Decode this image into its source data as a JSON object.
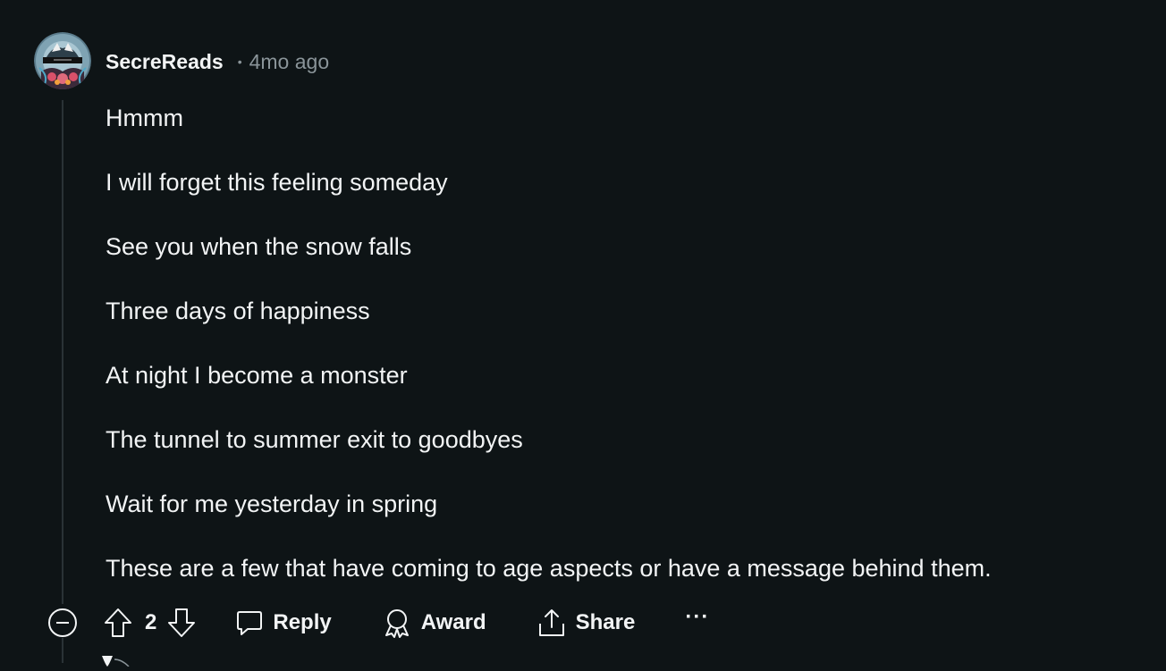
{
  "comment": {
    "username": "SecreReads",
    "separator": "•",
    "time": "4mo ago",
    "lines": [
      "Hmmm",
      "I will forget this feeling someday",
      "See you when the snow falls",
      "Three days of happiness",
      "At night I become a monster",
      "The tunnel to summer exit to goodbyes",
      "Wait for me yesterday in spring",
      "These are a few that have coming to age aspects or have a message behind them."
    ]
  },
  "actions": {
    "vote_count": "2",
    "reply_label": "Reply",
    "award_label": "Award",
    "share_label": "Share",
    "more_label": "···"
  },
  "icons": {
    "collapse": "minus-circle-icon",
    "upvote": "arrow-up-icon",
    "downvote": "arrow-down-icon",
    "reply": "speech-bubble-icon",
    "award": "award-ribbon-icon",
    "share": "share-upload-icon",
    "more": "more-dots-icon"
  },
  "colors": {
    "background": "#0e1416",
    "text": "#f2f4f5",
    "muted": "#8a9499",
    "thread_line": "#2a3236"
  }
}
